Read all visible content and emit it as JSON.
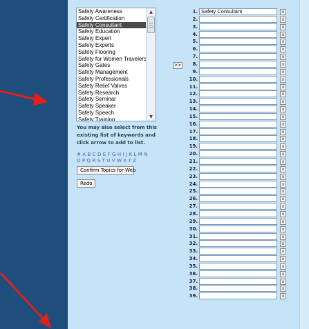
{
  "keywords": {
    "options": [
      "Safety Awareness",
      "Safety Certification",
      "Safety Consultant",
      "Safety Education",
      "Safety Expert",
      "Safety Experts",
      "Safety Flooring",
      "Safety for Women Travelers",
      "Safety Gates",
      "Safety Management",
      "Safety Professionals",
      "Safety Relief Valves",
      "Safety Research",
      "Safety Seminar",
      "Safety Speaker",
      "Safety Speech",
      "Safety Training"
    ],
    "selected": "Safety Consultant"
  },
  "help_text": "You may also select from this existing list of keywords and click arrow to add to list.",
  "alphabet": {
    "row1": [
      "#",
      "A",
      "B",
      "C",
      "D",
      "E",
      "F",
      "G",
      "H",
      "I",
      "J",
      "K",
      "L",
      "M",
      "N"
    ],
    "row2": [
      "O",
      "P",
      "Q",
      "R",
      "S",
      "T",
      "U",
      "V",
      "W",
      "X",
      "Y",
      "Z"
    ]
  },
  "buttons": {
    "confirm_label": "Confirm Topics for Web",
    "redo_label": "Redo",
    "add_label": ">>",
    "remove_label": "x"
  },
  "topics": [
    {
      "num": "1.",
      "value": "Safety Consultant"
    },
    {
      "num": "2.",
      "value": ""
    },
    {
      "num": "3.",
      "value": ""
    },
    {
      "num": "4.",
      "value": ""
    },
    {
      "num": "5.",
      "value": ""
    },
    {
      "num": "6.",
      "value": ""
    },
    {
      "num": "7.",
      "value": ""
    },
    {
      "num": "8.",
      "value": ""
    },
    {
      "num": "9.",
      "value": ""
    },
    {
      "num": "10.",
      "value": ""
    },
    {
      "num": "11.",
      "value": ""
    },
    {
      "num": "12.",
      "value": ""
    },
    {
      "num": "13.",
      "value": ""
    },
    {
      "num": "14.",
      "value": ""
    },
    {
      "num": "15.",
      "value": ""
    },
    {
      "num": "16.",
      "value": ""
    },
    {
      "num": "17.",
      "value": ""
    },
    {
      "num": "18.",
      "value": ""
    },
    {
      "num": "19.",
      "value": ""
    },
    {
      "num": "20.",
      "value": ""
    },
    {
      "num": "21.",
      "value": ""
    },
    {
      "num": "22.",
      "value": ""
    },
    {
      "num": "23.",
      "value": ""
    },
    {
      "num": "24.",
      "value": ""
    },
    {
      "num": "25.",
      "value": ""
    },
    {
      "num": "26.",
      "value": ""
    },
    {
      "num": "27.",
      "value": ""
    },
    {
      "num": "28.",
      "value": ""
    },
    {
      "num": "29.",
      "value": ""
    },
    {
      "num": "30.",
      "value": ""
    },
    {
      "num": "31.",
      "value": ""
    },
    {
      "num": "32.",
      "value": ""
    },
    {
      "num": "33.",
      "value": ""
    },
    {
      "num": "34.",
      "value": ""
    },
    {
      "num": "35.",
      "value": ""
    },
    {
      "num": "36.",
      "value": ""
    },
    {
      "num": "37.",
      "value": ""
    },
    {
      "num": "38.",
      "value": ""
    },
    {
      "num": "39.",
      "value": ""
    }
  ],
  "colors": {
    "sidebar": "#1e4f7c",
    "panel": "#c6e3f7",
    "annotation_arrow": "#e0201b",
    "alphabet_link": "#3a69a8"
  }
}
